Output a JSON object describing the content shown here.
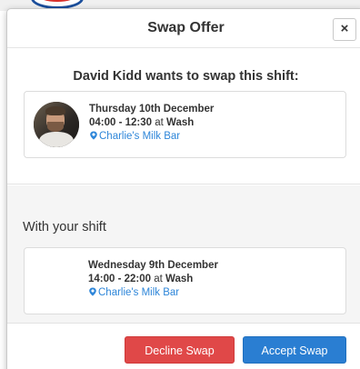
{
  "modal": {
    "title": "Swap Offer",
    "close_label": "×"
  },
  "offer": {
    "heading": "David Kidd wants to swap this shift:",
    "shift": {
      "date": "Thursday 10th December",
      "time": "04:00 - 12:30",
      "at": "at",
      "role": "Wash",
      "location": "Charlie's Milk Bar"
    }
  },
  "yours": {
    "heading": "With your shift",
    "shift": {
      "date": "Wednesday 9th December",
      "time": "14:00 - 22:00",
      "at": "at",
      "role": "Wash",
      "location": "Charlie's Milk Bar"
    }
  },
  "actions": {
    "decline_label": "Decline Swap",
    "accept_label": "Accept Swap"
  },
  "colors": {
    "decline": "#e04848",
    "accept": "#2a7ed2",
    "link": "#2e86d9"
  }
}
